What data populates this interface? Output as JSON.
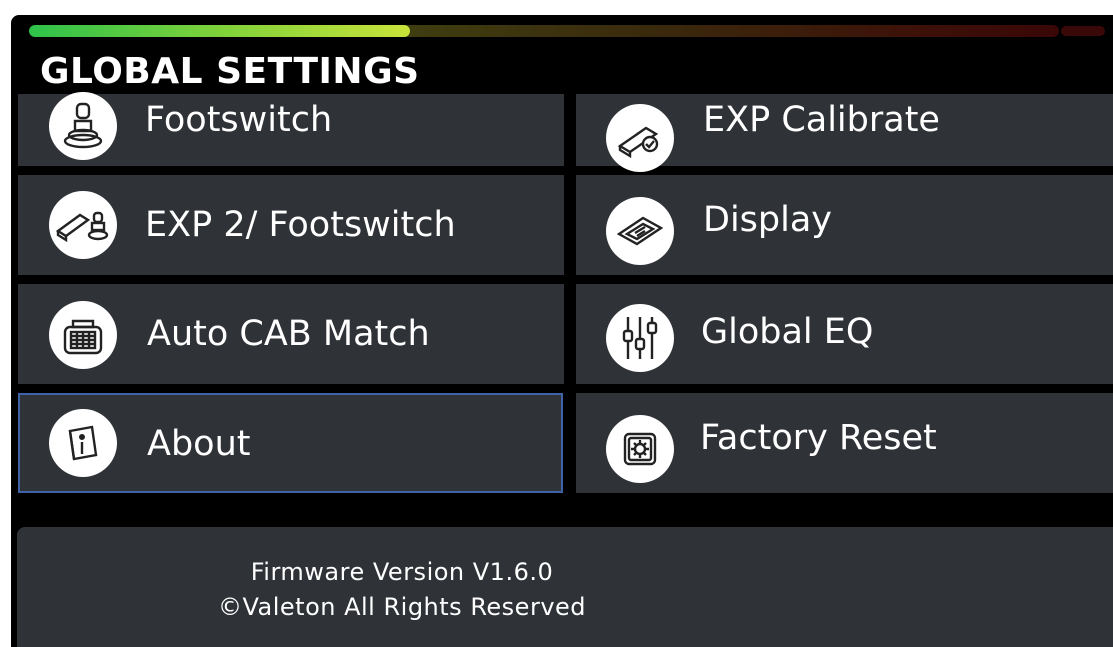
{
  "meter": {
    "level": 0.37
  },
  "title": "GLOBAL SETTINGS",
  "menu": [
    {
      "label": "Footswitch",
      "icon": "footswitch-icon"
    },
    {
      "label": "EXP Calibrate",
      "icon": "exp-calibrate-icon"
    },
    {
      "label": "EXP 2/ Footswitch",
      "icon": "exp2-footswitch-icon"
    },
    {
      "label": "Display",
      "icon": "display-icon"
    },
    {
      "label": "Auto CAB Match",
      "icon": "cab-icon"
    },
    {
      "label": "Global EQ",
      "icon": "eq-sliders-icon"
    },
    {
      "label": "About",
      "icon": "info-icon"
    },
    {
      "label": "Factory Reset",
      "icon": "factory-reset-icon"
    }
  ],
  "footer": {
    "firmware": "Firmware Version V1.6.0",
    "copyright": "©Valeton All Rights Reserved"
  },
  "colors": {
    "background": "#000000",
    "tile": "#2f3237",
    "selected_border": "#3f63a8",
    "meter_green": "#7fd13a",
    "meter_red": "#3a0707"
  }
}
